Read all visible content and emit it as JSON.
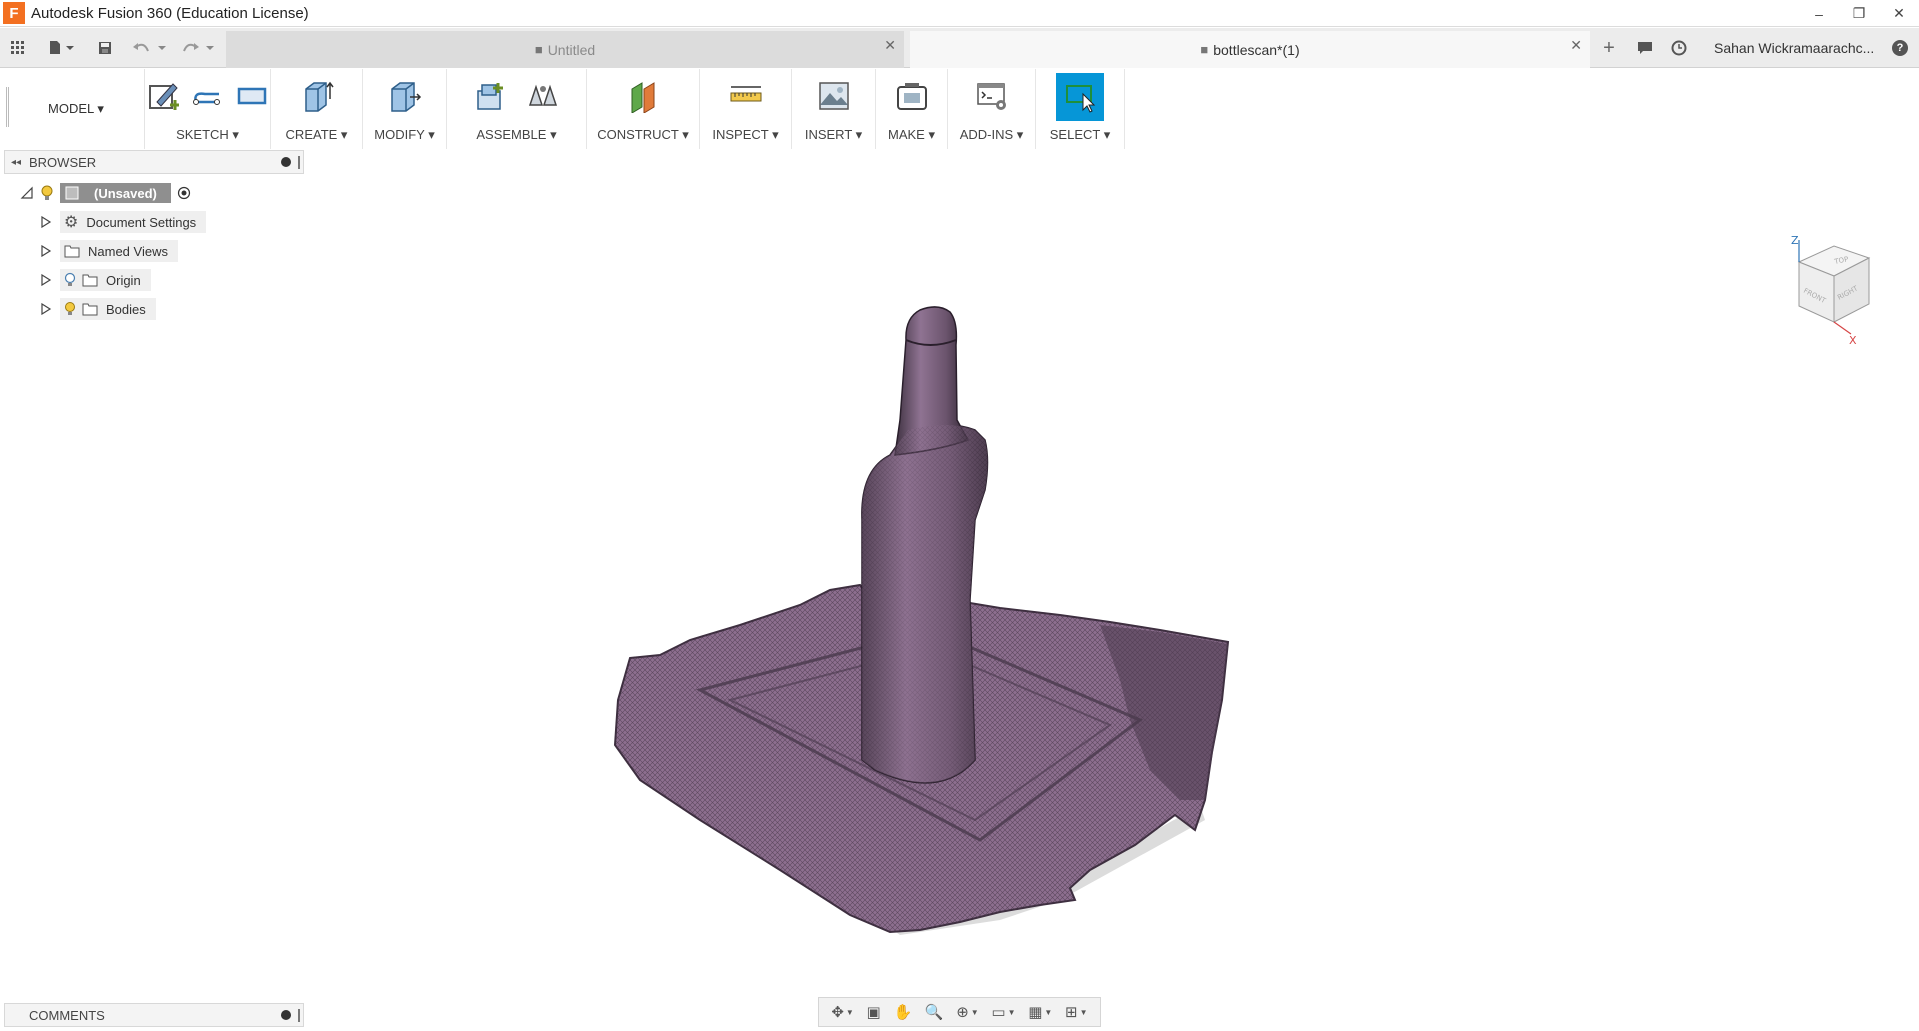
{
  "window": {
    "title": "Autodesk Fusion 360 (Education License)",
    "logo_letter": "F",
    "minimize": "–",
    "restore": "❐",
    "close": "✕"
  },
  "quick_access": {
    "data_panel_icon": "grid-icon",
    "file_icon": "file-icon",
    "save_icon": "save-icon",
    "undo_icon": "undo-icon",
    "redo_icon": "redo-icon"
  },
  "tabs": [
    {
      "label": "Untitled",
      "active": false,
      "close": "✕"
    },
    {
      "label": "bottlescan*(1)",
      "active": true,
      "close": "✕"
    }
  ],
  "tabbar_right": {
    "new_tab": "+",
    "user_name": "Sahan Wickramaarachc...",
    "help": "?"
  },
  "toolbar": {
    "workspace": "MODEL ▾",
    "groups": [
      {
        "label": "SKETCH ▾"
      },
      {
        "label": "CREATE ▾"
      },
      {
        "label": "MODIFY ▾"
      },
      {
        "label": "ASSEMBLE ▾"
      },
      {
        "label": "CONSTRUCT ▾"
      },
      {
        "label": "INSPECT ▾"
      },
      {
        "label": "INSERT ▾"
      },
      {
        "label": "MAKE ▾"
      },
      {
        "label": "ADD-INS ▾"
      },
      {
        "label": "SELECT ▾"
      }
    ]
  },
  "browser": {
    "title": "BROWSER",
    "collapse": "◂◂",
    "root": "(Unsaved)",
    "items": [
      {
        "label": "Document Settings",
        "icon": "gear-icon"
      },
      {
        "label": "Named Views",
        "icon": "folder-icon"
      },
      {
        "label": "Origin",
        "icon": "folder-icon"
      },
      {
        "label": "Bodies",
        "icon": "folder-icon"
      }
    ]
  },
  "comments": {
    "title": "COMMENTS"
  },
  "viewcube": {
    "top": "TOP",
    "front": "FRONT",
    "right": "RIGHT",
    "z_axis": "Z",
    "x_axis": "X"
  },
  "colors": {
    "accent": "#0696d7",
    "mesh": "#8a6c8c",
    "mesh_dark": "#4a3a4c",
    "logo": "#f37021"
  }
}
